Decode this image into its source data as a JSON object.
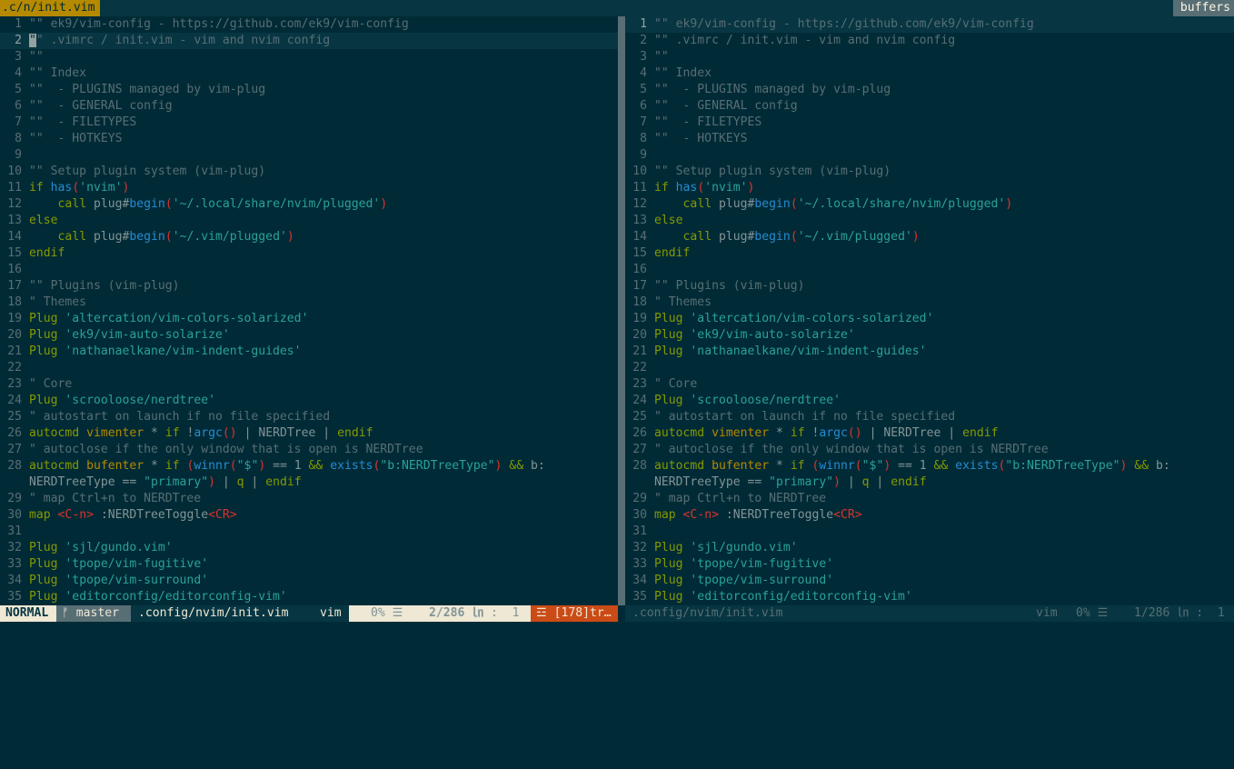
{
  "tabline": {
    "active_tab": ".c/n/init.vim",
    "buffers_label": "buffers"
  },
  "panes": [
    {
      "current_line": 2,
      "lines": [
        {
          "n": "1",
          "segs": [
            [
              "c",
              "\"\" ek9/vim-config - https://github.com/ek9/vim-config"
            ]
          ]
        },
        {
          "n": "2",
          "segs": [
            [
              "cur",
              "\""
            ],
            [
              "c",
              "\" .vimrc / init.vim - vim and nvim config"
            ]
          ]
        },
        {
          "n": "3",
          "segs": [
            [
              "c",
              "\"\""
            ]
          ]
        },
        {
          "n": "4",
          "segs": [
            [
              "c",
              "\"\" Index"
            ]
          ]
        },
        {
          "n": "5",
          "segs": [
            [
              "c",
              "\"\"  - PLUGINS managed by vim-plug"
            ]
          ]
        },
        {
          "n": "6",
          "segs": [
            [
              "c",
              "\"\"  - GENERAL config"
            ]
          ]
        },
        {
          "n": "7",
          "segs": [
            [
              "c",
              "\"\"  - FILETYPES"
            ]
          ]
        },
        {
          "n": "8",
          "segs": [
            [
              "c",
              "\"\"  - HOTKEYS"
            ]
          ]
        },
        {
          "n": "9",
          "segs": []
        },
        {
          "n": "10",
          "segs": [
            [
              "c",
              "\"\" Setup plugin system (vim-plug)"
            ]
          ]
        },
        {
          "n": "11",
          "segs": [
            [
              "k",
              "if "
            ],
            [
              "f",
              "has"
            ],
            [
              "p",
              "("
            ],
            [
              "s",
              "'nvim'"
            ],
            [
              "p",
              ")"
            ]
          ]
        },
        {
          "n": "12",
          "segs": [
            [
              "",
              "    "
            ],
            [
              "k",
              "call "
            ],
            [
              "",
              "plug#"
            ],
            [
              "f",
              "begin"
            ],
            [
              "p",
              "("
            ],
            [
              "s",
              "'~/.local/share/nvim/plugged'"
            ],
            [
              "p",
              ")"
            ]
          ]
        },
        {
          "n": "13",
          "segs": [
            [
              "k",
              "else"
            ]
          ]
        },
        {
          "n": "14",
          "segs": [
            [
              "",
              "    "
            ],
            [
              "k",
              "call "
            ],
            [
              "",
              "plug#"
            ],
            [
              "f",
              "begin"
            ],
            [
              "p",
              "("
            ],
            [
              "s",
              "'~/.vim/plugged'"
            ],
            [
              "p",
              ")"
            ]
          ]
        },
        {
          "n": "15",
          "segs": [
            [
              "k",
              "endif"
            ]
          ]
        },
        {
          "n": "16",
          "segs": []
        },
        {
          "n": "17",
          "segs": [
            [
              "c",
              "\"\" Plugins (vim-plug)"
            ]
          ]
        },
        {
          "n": "18",
          "segs": [
            [
              "c",
              "\" Themes"
            ]
          ]
        },
        {
          "n": "19",
          "segs": [
            [
              "k",
              "Plug "
            ],
            [
              "s",
              "'altercation/vim-colors-solarized'"
            ]
          ]
        },
        {
          "n": "20",
          "segs": [
            [
              "k",
              "Plug "
            ],
            [
              "s",
              "'ek9/vim-auto-solarize'"
            ]
          ]
        },
        {
          "n": "21",
          "segs": [
            [
              "k",
              "Plug "
            ],
            [
              "s",
              "'nathanaelkane/vim-indent-guides'"
            ]
          ]
        },
        {
          "n": "22",
          "segs": []
        },
        {
          "n": "23",
          "segs": [
            [
              "c",
              "\" Core"
            ]
          ]
        },
        {
          "n": "24",
          "segs": [
            [
              "k",
              "Plug "
            ],
            [
              "s",
              "'scrooloose/nerdtree'"
            ]
          ]
        },
        {
          "n": "25",
          "segs": [
            [
              "c",
              "\" autostart on launch if no file specified"
            ]
          ]
        },
        {
          "n": "26",
          "segs": [
            [
              "k",
              "autocmd "
            ],
            [
              "a",
              "vimenter "
            ],
            [
              "",
              "* "
            ],
            [
              "k",
              "if "
            ],
            [
              "",
              "!"
            ],
            [
              "f",
              "argc"
            ],
            [
              "p",
              "()"
            ],
            [
              "",
              " | NERDTree | "
            ],
            [
              "k",
              "endif"
            ]
          ]
        },
        {
          "n": "27",
          "segs": [
            [
              "c",
              "\" autoclose if the only window that is open is NERDTree"
            ]
          ]
        },
        {
          "n": "28",
          "segs": [
            [
              "k",
              "autocmd "
            ],
            [
              "a",
              "bufenter "
            ],
            [
              "",
              "* "
            ],
            [
              "k",
              "if "
            ],
            [
              "p",
              "("
            ],
            [
              "f",
              "winnr"
            ],
            [
              "p",
              "("
            ],
            [
              "s",
              "\"$\""
            ],
            [
              "p",
              ")"
            ],
            [
              "",
              " == 1 "
            ],
            [
              "k",
              "&& "
            ],
            [
              "f",
              "exists"
            ],
            [
              "p",
              "("
            ],
            [
              "s",
              "\"b:NERDTreeType\""
            ],
            [
              "p",
              ")"
            ],
            [
              "k",
              " && "
            ],
            [
              "",
              "b:"
            ]
          ]
        },
        {
          "n": "",
          "segs": [
            [
              "",
              "NERDTreeType == "
            ],
            [
              "s",
              "\"primary\""
            ],
            [
              "p",
              ")"
            ],
            [
              "",
              " | "
            ],
            [
              "k",
              "q"
            ],
            [
              "",
              " | "
            ],
            [
              "k",
              "endif"
            ]
          ]
        },
        {
          "n": "29",
          "segs": [
            [
              "c",
              "\" map Ctrl+n to NERDTree"
            ]
          ]
        },
        {
          "n": "30",
          "segs": [
            [
              "k",
              "map "
            ],
            [
              "p",
              "<C-n> "
            ],
            [
              "",
              ":NERDTreeToggle"
            ],
            [
              "p",
              "<CR>"
            ]
          ]
        },
        {
          "n": "31",
          "segs": []
        },
        {
          "n": "32",
          "segs": [
            [
              "k",
              "Plug "
            ],
            [
              "s",
              "'sjl/gundo.vim'"
            ]
          ]
        },
        {
          "n": "33",
          "segs": [
            [
              "k",
              "Plug "
            ],
            [
              "s",
              "'tpope/vim-fugitive'"
            ]
          ]
        },
        {
          "n": "34",
          "segs": [
            [
              "k",
              "Plug "
            ],
            [
              "s",
              "'tpope/vim-surround'"
            ]
          ]
        },
        {
          "n": "35",
          "segs": [
            [
              "k",
              "Plug "
            ],
            [
              "s",
              "'editorconfig/editorconfig-vim'"
            ]
          ]
        }
      ]
    },
    {
      "current_line": 1,
      "lines": [
        {
          "n": "1",
          "segs": [
            [
              "c",
              "\"\" ek9/vim-config - https://github.com/ek9/vim-config"
            ]
          ]
        },
        {
          "n": "2",
          "segs": [
            [
              "c",
              "\"\" .vimrc / init.vim - vim and nvim config"
            ]
          ]
        },
        {
          "n": "3",
          "segs": [
            [
              "c",
              "\"\""
            ]
          ]
        },
        {
          "n": "4",
          "segs": [
            [
              "c",
              "\"\" Index"
            ]
          ]
        },
        {
          "n": "5",
          "segs": [
            [
              "c",
              "\"\"  - PLUGINS managed by vim-plug"
            ]
          ]
        },
        {
          "n": "6",
          "segs": [
            [
              "c",
              "\"\"  - GENERAL config"
            ]
          ]
        },
        {
          "n": "7",
          "segs": [
            [
              "c",
              "\"\"  - FILETYPES"
            ]
          ]
        },
        {
          "n": "8",
          "segs": [
            [
              "c",
              "\"\"  - HOTKEYS"
            ]
          ]
        },
        {
          "n": "9",
          "segs": []
        },
        {
          "n": "10",
          "segs": [
            [
              "c",
              "\"\" Setup plugin system (vim-plug)"
            ]
          ]
        },
        {
          "n": "11",
          "segs": [
            [
              "k",
              "if "
            ],
            [
              "f",
              "has"
            ],
            [
              "p",
              "("
            ],
            [
              "s",
              "'nvim'"
            ],
            [
              "p",
              ")"
            ]
          ]
        },
        {
          "n": "12",
          "segs": [
            [
              "",
              "    "
            ],
            [
              "k",
              "call "
            ],
            [
              "",
              "plug#"
            ],
            [
              "f",
              "begin"
            ],
            [
              "p",
              "("
            ],
            [
              "s",
              "'~/.local/share/nvim/plugged'"
            ],
            [
              "p",
              ")"
            ]
          ]
        },
        {
          "n": "13",
          "segs": [
            [
              "k",
              "else"
            ]
          ]
        },
        {
          "n": "14",
          "segs": [
            [
              "",
              "    "
            ],
            [
              "k",
              "call "
            ],
            [
              "",
              "plug#"
            ],
            [
              "f",
              "begin"
            ],
            [
              "p",
              "("
            ],
            [
              "s",
              "'~/.vim/plugged'"
            ],
            [
              "p",
              ")"
            ]
          ]
        },
        {
          "n": "15",
          "segs": [
            [
              "k",
              "endif"
            ]
          ]
        },
        {
          "n": "16",
          "segs": []
        },
        {
          "n": "17",
          "segs": [
            [
              "c",
              "\"\" Plugins (vim-plug)"
            ]
          ]
        },
        {
          "n": "18",
          "segs": [
            [
              "c",
              "\" Themes"
            ]
          ]
        },
        {
          "n": "19",
          "segs": [
            [
              "k",
              "Plug "
            ],
            [
              "s",
              "'altercation/vim-colors-solarized'"
            ]
          ]
        },
        {
          "n": "20",
          "segs": [
            [
              "k",
              "Plug "
            ],
            [
              "s",
              "'ek9/vim-auto-solarize'"
            ]
          ]
        },
        {
          "n": "21",
          "segs": [
            [
              "k",
              "Plug "
            ],
            [
              "s",
              "'nathanaelkane/vim-indent-guides'"
            ]
          ]
        },
        {
          "n": "22",
          "segs": []
        },
        {
          "n": "23",
          "segs": [
            [
              "c",
              "\" Core"
            ]
          ]
        },
        {
          "n": "24",
          "segs": [
            [
              "k",
              "Plug "
            ],
            [
              "s",
              "'scrooloose/nerdtree'"
            ]
          ]
        },
        {
          "n": "25",
          "segs": [
            [
              "c",
              "\" autostart on launch if no file specified"
            ]
          ]
        },
        {
          "n": "26",
          "segs": [
            [
              "k",
              "autocmd "
            ],
            [
              "a",
              "vimenter "
            ],
            [
              "",
              "* "
            ],
            [
              "k",
              "if "
            ],
            [
              "",
              "!"
            ],
            [
              "f",
              "argc"
            ],
            [
              "p",
              "()"
            ],
            [
              "",
              " | NERDTree | "
            ],
            [
              "k",
              "endif"
            ]
          ]
        },
        {
          "n": "27",
          "segs": [
            [
              "c",
              "\" autoclose if the only window that is open is NERDTree"
            ]
          ]
        },
        {
          "n": "28",
          "segs": [
            [
              "k",
              "autocmd "
            ],
            [
              "a",
              "bufenter "
            ],
            [
              "",
              "* "
            ],
            [
              "k",
              "if "
            ],
            [
              "p",
              "("
            ],
            [
              "f",
              "winnr"
            ],
            [
              "p",
              "("
            ],
            [
              "s",
              "\"$\""
            ],
            [
              "p",
              ")"
            ],
            [
              "",
              " == 1 "
            ],
            [
              "k",
              "&& "
            ],
            [
              "f",
              "exists"
            ],
            [
              "p",
              "("
            ],
            [
              "s",
              "\"b:NERDTreeType\""
            ],
            [
              "p",
              ")"
            ],
            [
              "k",
              " && "
            ],
            [
              "",
              "b:"
            ]
          ]
        },
        {
          "n": "",
          "segs": [
            [
              "",
              "NERDTreeType == "
            ],
            [
              "s",
              "\"primary\""
            ],
            [
              "p",
              ")"
            ],
            [
              "",
              " | "
            ],
            [
              "k",
              "q"
            ],
            [
              "",
              " | "
            ],
            [
              "k",
              "endif"
            ]
          ]
        },
        {
          "n": "29",
          "segs": [
            [
              "c",
              "\" map Ctrl+n to NERDTree"
            ]
          ]
        },
        {
          "n": "30",
          "segs": [
            [
              "k",
              "map "
            ],
            [
              "p",
              "<C-n> "
            ],
            [
              "",
              ":NERDTreeToggle"
            ],
            [
              "p",
              "<CR>"
            ]
          ]
        },
        {
          "n": "31",
          "segs": []
        },
        {
          "n": "32",
          "segs": [
            [
              "k",
              "Plug "
            ],
            [
              "s",
              "'sjl/gundo.vim'"
            ]
          ]
        },
        {
          "n": "33",
          "segs": [
            [
              "k",
              "Plug "
            ],
            [
              "s",
              "'tpope/vim-fugitive'"
            ]
          ]
        },
        {
          "n": "34",
          "segs": [
            [
              "k",
              "Plug "
            ],
            [
              "s",
              "'tpope/vim-surround'"
            ]
          ]
        },
        {
          "n": "35",
          "segs": [
            [
              "k",
              "Plug "
            ],
            [
              "s",
              "'editorconfig/editorconfig-vim'"
            ]
          ]
        }
      ]
    }
  ],
  "statusline_left": {
    "mode": "NORMAL",
    "branch": "ᚠ master",
    "file": ".config/nvim/init.vim",
    "filetype": "vim",
    "percent": "0% ☰",
    "line": "2/286 ㏑",
    "col": ":  1",
    "trailing": "☲ [178]tr…"
  },
  "statusline_right": {
    "file": ".config/nvim/init.vim",
    "filetype": "vim",
    "percent": "0% ☰",
    "position": "1/286 ㏑ :  1"
  },
  "colors": {
    "base03": "#002b36",
    "base02": "#073642",
    "base01": "#586e75",
    "yellow": "#b58900",
    "orange": "#cb4b16",
    "red": "#dc322f",
    "blue": "#268bd2",
    "cyan": "#2aa198",
    "green": "#859900"
  }
}
